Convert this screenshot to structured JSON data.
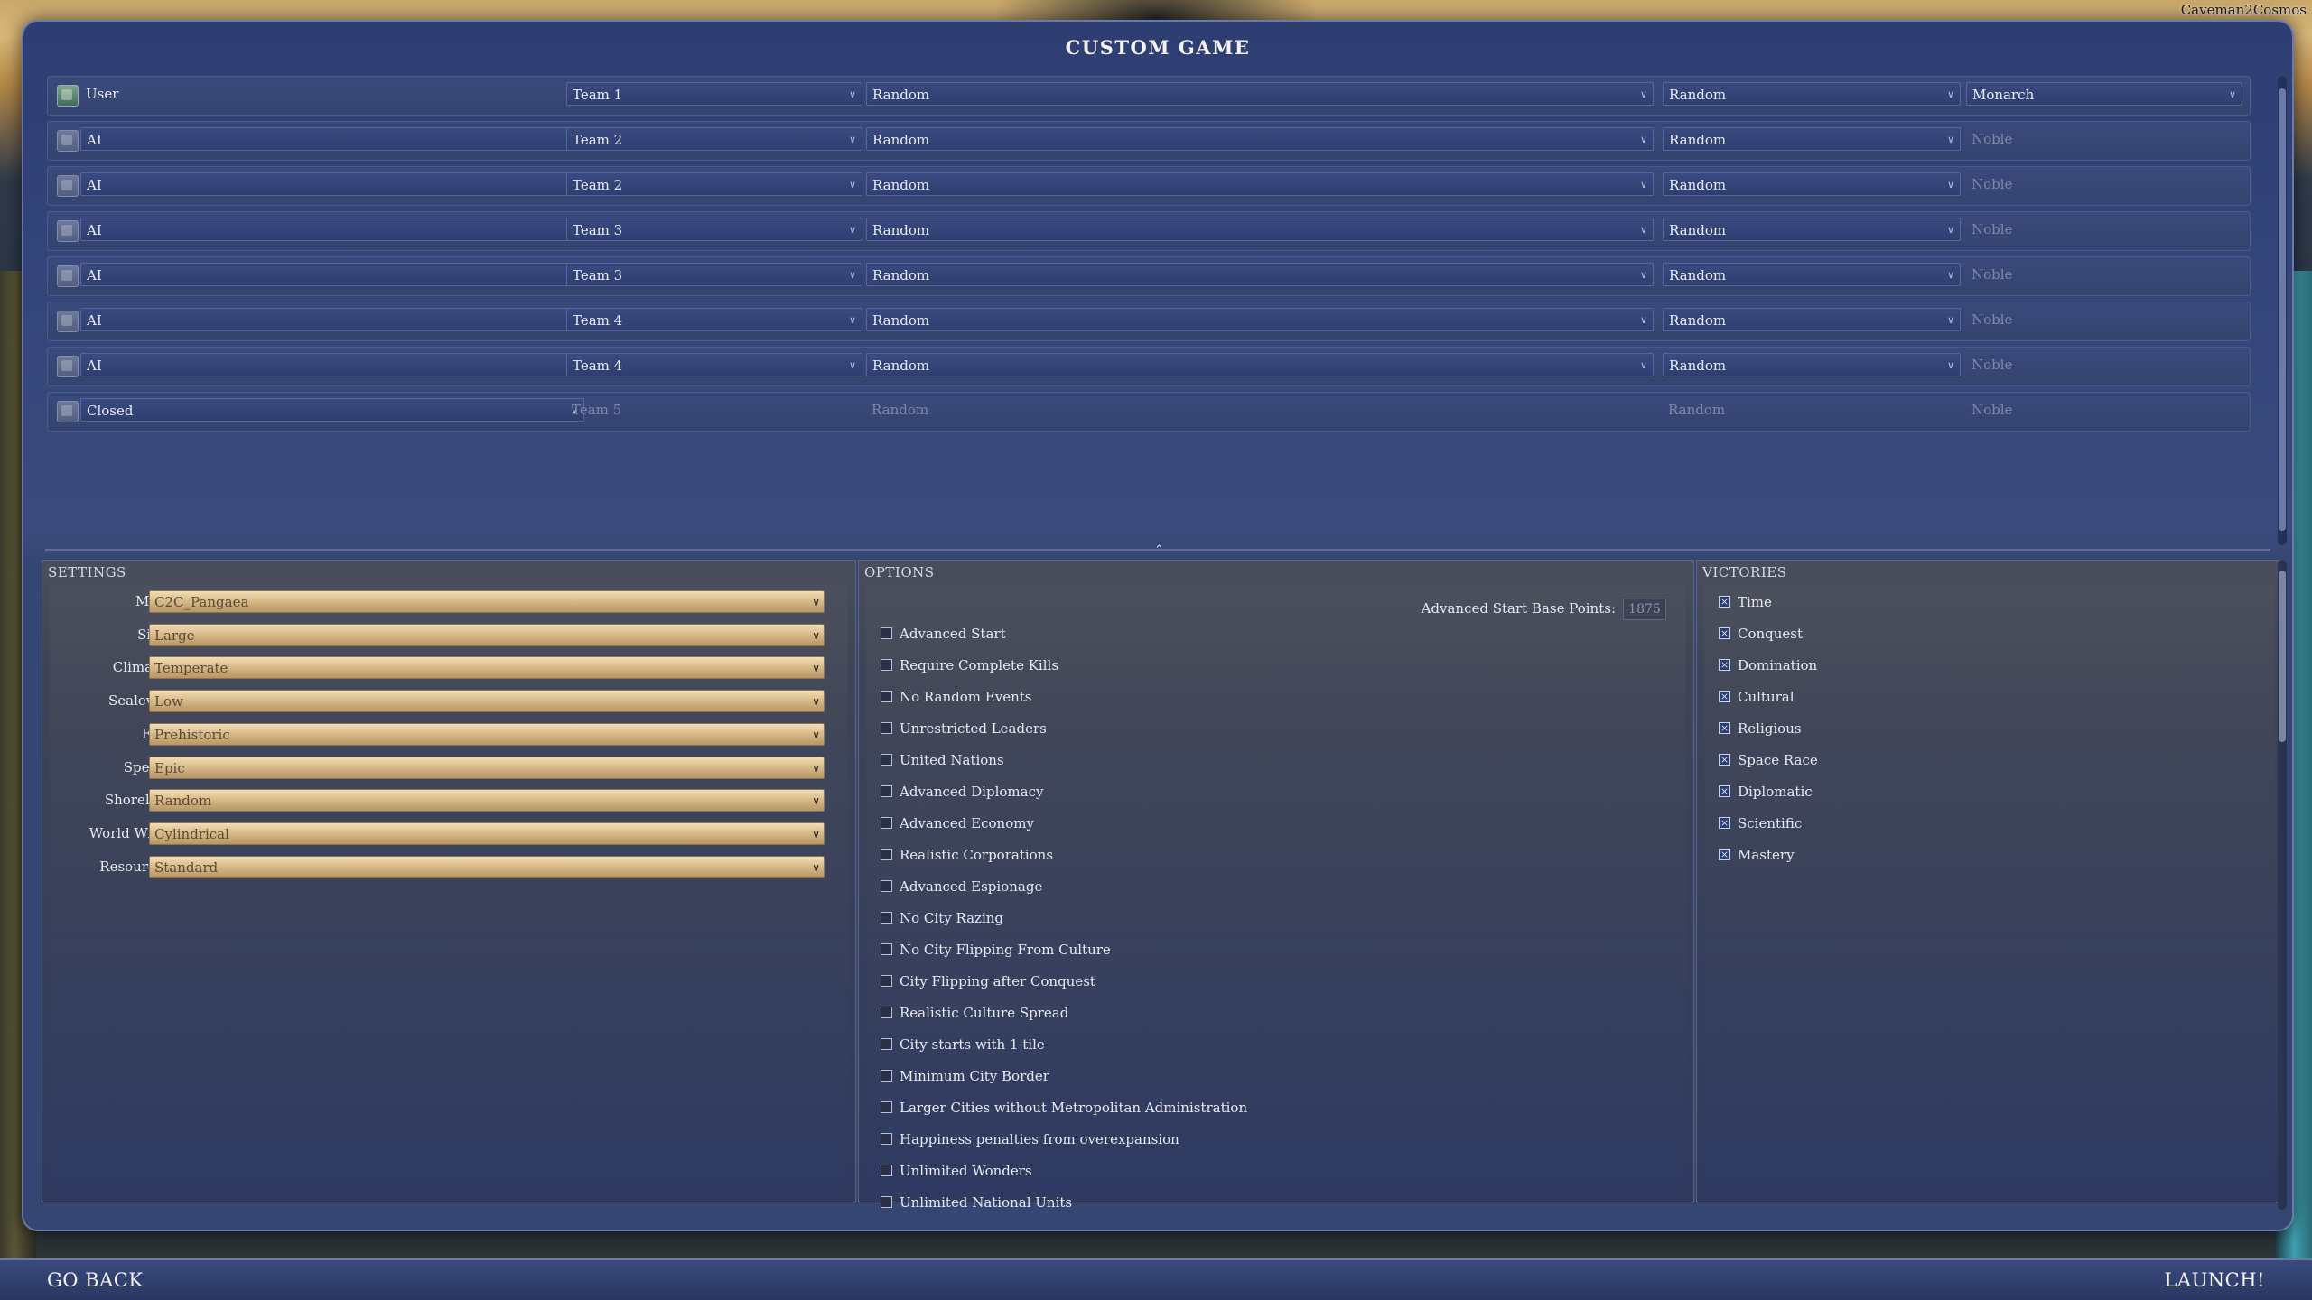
{
  "corner_label": "Caveman2Cosmos",
  "title": "CUSTOM GAME",
  "players": [
    {
      "type": "User",
      "team": "Team 1",
      "civ": "Random",
      "leader": "Random",
      "difficulty": "Monarch",
      "type_dropdown": false,
      "active": true,
      "user": true
    },
    {
      "type": "AI",
      "team": "Team 2",
      "civ": "Random",
      "leader": "Random",
      "difficulty": "Noble",
      "type_dropdown": true,
      "active": true,
      "user": false
    },
    {
      "type": "AI",
      "team": "Team 2",
      "civ": "Random",
      "leader": "Random",
      "difficulty": "Noble",
      "type_dropdown": true,
      "active": true,
      "user": false
    },
    {
      "type": "AI",
      "team": "Team 3",
      "civ": "Random",
      "leader": "Random",
      "difficulty": "Noble",
      "type_dropdown": true,
      "active": true,
      "user": false
    },
    {
      "type": "AI",
      "team": "Team 3",
      "civ": "Random",
      "leader": "Random",
      "difficulty": "Noble",
      "type_dropdown": true,
      "active": true,
      "user": false
    },
    {
      "type": "AI",
      "team": "Team 4",
      "civ": "Random",
      "leader": "Random",
      "difficulty": "Noble",
      "type_dropdown": true,
      "active": true,
      "user": false
    },
    {
      "type": "AI",
      "team": "Team 4",
      "civ": "Random",
      "leader": "Random",
      "difficulty": "Noble",
      "type_dropdown": true,
      "active": true,
      "user": false
    },
    {
      "type": "Closed",
      "team": "Team 5",
      "civ": "Random",
      "leader": "Random",
      "difficulty": "Noble",
      "type_dropdown": true,
      "active": false,
      "user": false
    }
  ],
  "settings": {
    "header": "SETTINGS",
    "items": [
      {
        "label": "Map:",
        "value": "C2C_Pangaea"
      },
      {
        "label": "Size:",
        "value": "Large"
      },
      {
        "label": "Climate:",
        "value": "Temperate"
      },
      {
        "label": "Sealevel:",
        "value": "Low"
      },
      {
        "label": "Era:",
        "value": "Prehistoric"
      },
      {
        "label": "Speed:",
        "value": "Epic"
      },
      {
        "label": "Shoreline",
        "value": "Random"
      },
      {
        "label": "World Wrap",
        "value": "Cylindrical"
      },
      {
        "label": "Resources",
        "value": "Standard"
      }
    ]
  },
  "options": {
    "header": "OPTIONS",
    "advanced_start_label": "Advanced Start Base Points:",
    "advanced_start_value": "1875",
    "items": [
      {
        "label": "Advanced Start",
        "checked": false
      },
      {
        "label": "Require Complete Kills",
        "checked": false
      },
      {
        "label": "No Random Events",
        "checked": false
      },
      {
        "label": "Unrestricted Leaders",
        "checked": false
      },
      {
        "label": "United Nations",
        "checked": false
      },
      {
        "label": "Advanced Diplomacy",
        "checked": false
      },
      {
        "label": "Advanced Economy",
        "checked": false
      },
      {
        "label": "Realistic Corporations",
        "checked": false
      },
      {
        "label": "Advanced Espionage",
        "checked": false
      },
      {
        "label": "No City Razing",
        "checked": false
      },
      {
        "label": "No City Flipping From Culture",
        "checked": false
      },
      {
        "label": "City Flipping after Conquest",
        "checked": false
      },
      {
        "label": "Realistic Culture Spread",
        "checked": false
      },
      {
        "label": "City starts with 1 tile",
        "checked": false
      },
      {
        "label": "Minimum City Border",
        "checked": false
      },
      {
        "label": "Larger Cities without Metropolitan Administration",
        "checked": false
      },
      {
        "label": "Happiness penalties from overexpansion",
        "checked": false
      },
      {
        "label": "Unlimited Wonders",
        "checked": false
      },
      {
        "label": "Unlimited National Units",
        "checked": false
      }
    ]
  },
  "victories": {
    "header": "VICTORIES",
    "items": [
      {
        "label": "Time",
        "checked": true
      },
      {
        "label": "Conquest",
        "checked": true
      },
      {
        "label": "Domination",
        "checked": true
      },
      {
        "label": "Cultural",
        "checked": true
      },
      {
        "label": "Religious",
        "checked": true
      },
      {
        "label": "Space Race",
        "checked": true
      },
      {
        "label": "Diplomatic",
        "checked": true
      },
      {
        "label": "Scientific",
        "checked": true
      },
      {
        "label": "Mastery",
        "checked": true
      }
    ]
  },
  "footer": {
    "back": "GO BACK",
    "launch": "LAUNCH!"
  }
}
